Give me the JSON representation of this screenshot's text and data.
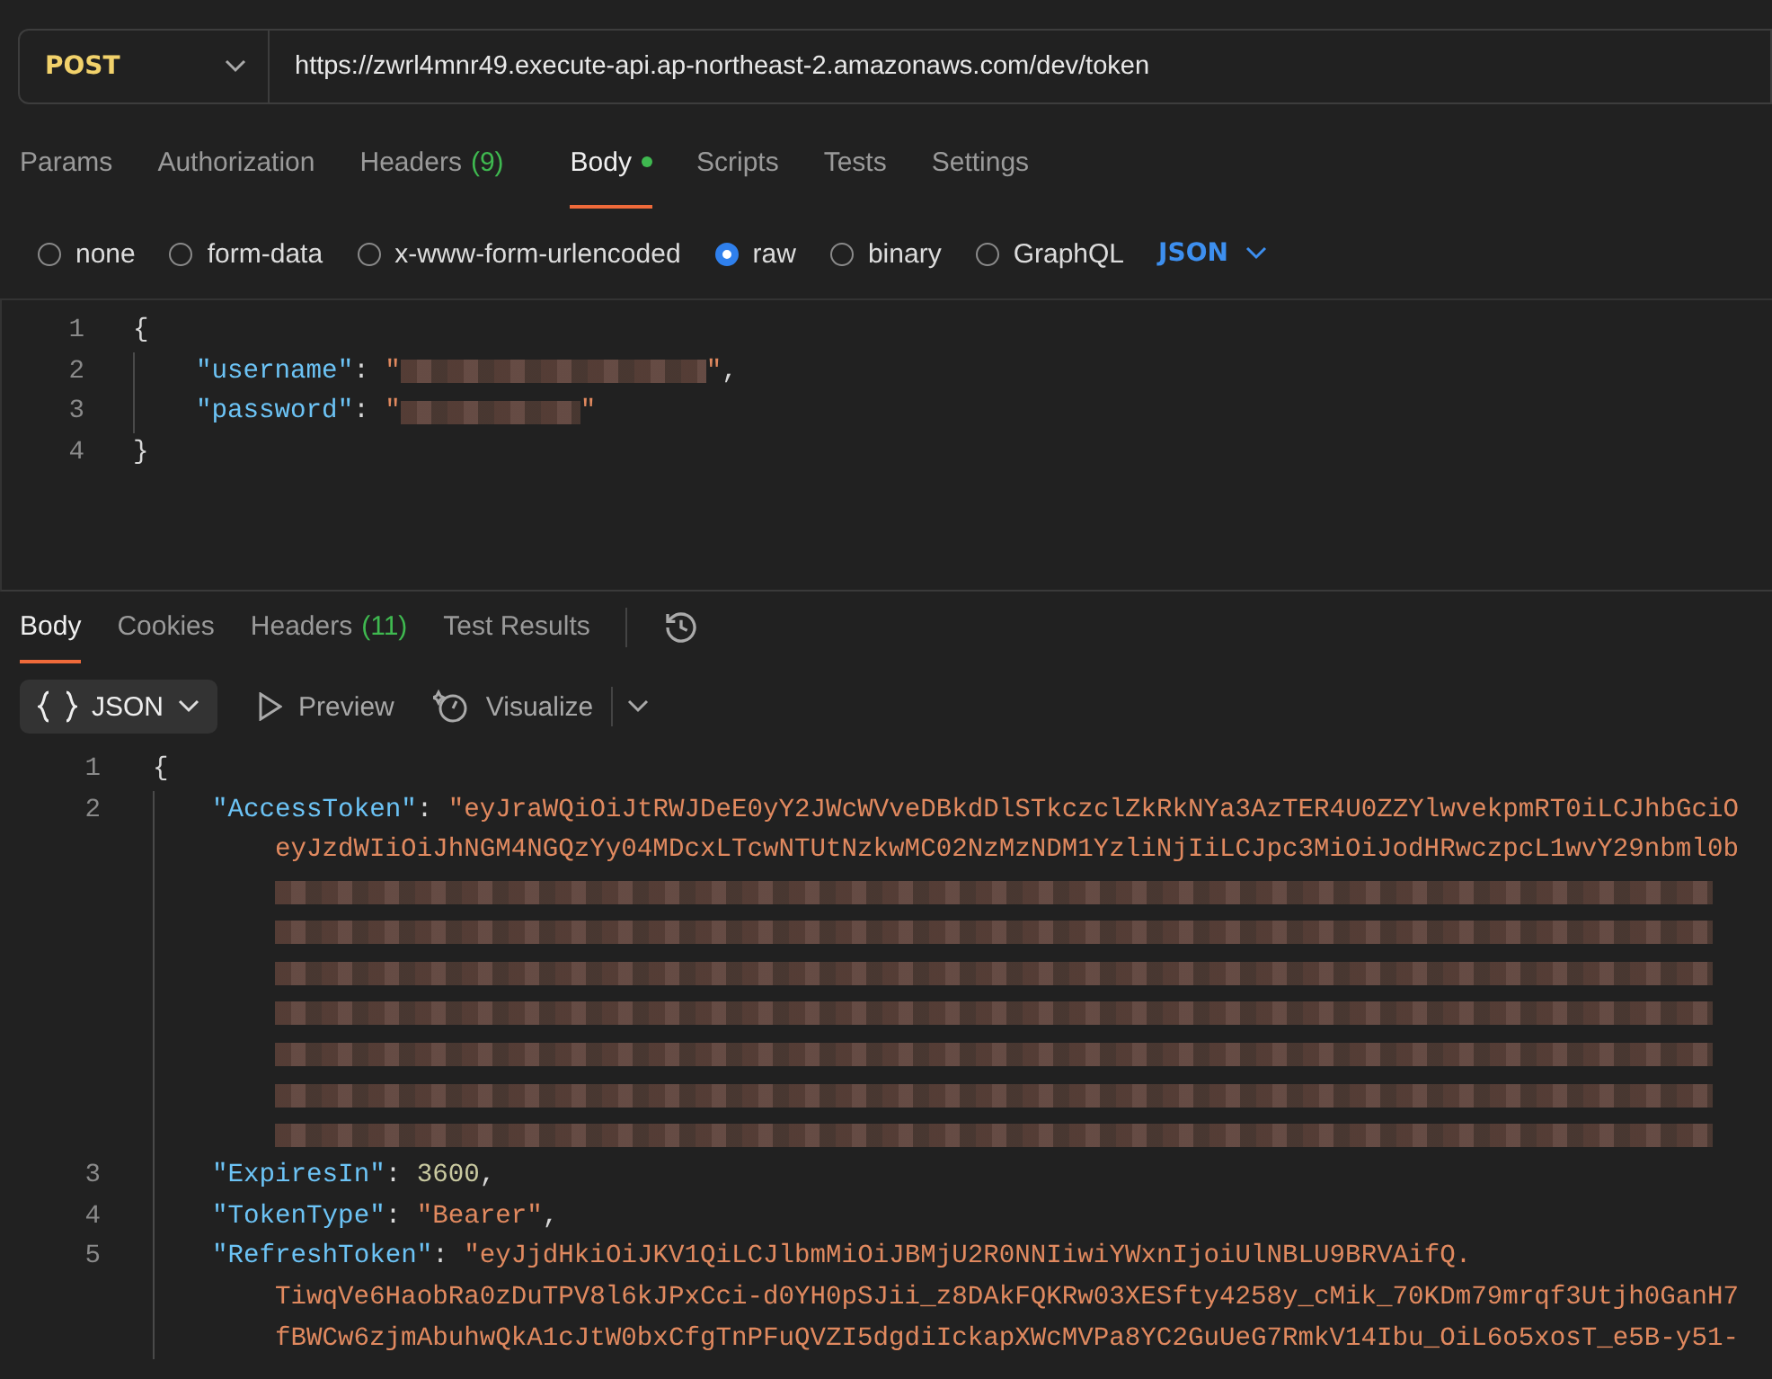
{
  "request": {
    "method": "POST",
    "url": "https://zwrl4mnr49.execute-api.ap-northeast-2.amazonaws.com/dev/token"
  },
  "request_tabs": [
    {
      "label": "Params",
      "selected": false
    },
    {
      "label": "Authorization",
      "selected": false
    },
    {
      "label": "Headers",
      "count": "(9)",
      "selected": false
    },
    {
      "label": "Body",
      "dot": true,
      "selected": true
    },
    {
      "label": "Scripts",
      "selected": false
    },
    {
      "label": "Tests",
      "selected": false
    },
    {
      "label": "Settings",
      "selected": false
    }
  ],
  "body_types": [
    {
      "label": "none",
      "selected": false
    },
    {
      "label": "form-data",
      "selected": false
    },
    {
      "label": "x-www-form-urlencoded",
      "selected": false
    },
    {
      "label": "raw",
      "selected": true
    },
    {
      "label": "binary",
      "selected": false
    },
    {
      "label": "GraphQL",
      "selected": false
    }
  ],
  "raw_format": "JSON",
  "request_body": [
    {
      "number": "1",
      "tokens": [
        {
          "kind": "punct",
          "text": "{"
        }
      ]
    },
    {
      "number": "2",
      "tokens": [
        {
          "kind": "key",
          "text": "\"username\""
        },
        {
          "kind": "punct",
          "text": ": "
        },
        {
          "kind": "string",
          "text": "\""
        },
        {
          "kind": "redacted"
        },
        {
          "kind": "string",
          "text": "\""
        },
        {
          "kind": "punct",
          "text": ","
        }
      ]
    },
    {
      "number": "3",
      "tokens": [
        {
          "kind": "key",
          "text": "\"password\""
        },
        {
          "kind": "punct",
          "text": ": "
        },
        {
          "kind": "string",
          "text": "\""
        },
        {
          "kind": "redacted"
        },
        {
          "kind": "string",
          "text": "\""
        }
      ]
    },
    {
      "number": "4",
      "tokens": [
        {
          "kind": "punct",
          "text": "}"
        }
      ]
    }
  ],
  "response_tabs": [
    {
      "label": "Body",
      "selected": true
    },
    {
      "label": "Cookies",
      "selected": false
    },
    {
      "label": "Headers",
      "count": "(11)",
      "selected": false
    },
    {
      "label": "Test Results",
      "selected": false
    }
  ],
  "response_view": {
    "format": "JSON",
    "preview": "Preview",
    "visualize": "Visualize"
  },
  "response_body": [
    {
      "number": "1",
      "tokens": [
        {
          "kind": "punct",
          "text": "{"
        }
      ]
    },
    {
      "number": "2",
      "tokens": [
        {
          "kind": "key",
          "text": "\"AccessToken\""
        },
        {
          "kind": "punct",
          "text": ": "
        },
        {
          "kind": "string",
          "text": "\"eyJraWQiOiJtRWJDeE0yY2JWcWVveDBkdDlSTkczclZkRkNYa3AzTER4U0ZZYlwvekpmRT0iLCJhbGciO"
        }
      ]
    },
    {
      "tokens": [
        {
          "kind": "string",
          "text": "eyJzdWIiOiJhNGM4NGQzYy04MDcxLTcwNTUtNzkwMC02NzMzNDM1YzliNjIiLCJpc3MiOiJodHRwczpcL1wvY29nbml0b"
        }
      ]
    },
    {
      "tokens": [
        {
          "kind": "redacted"
        }
      ]
    },
    {
      "tokens": [
        {
          "kind": "redacted"
        }
      ]
    },
    {
      "tokens": [
        {
          "kind": "redacted"
        }
      ]
    },
    {
      "tokens": [
        {
          "kind": "redacted"
        }
      ]
    },
    {
      "tokens": [
        {
          "kind": "redacted"
        }
      ]
    },
    {
      "tokens": [
        {
          "kind": "redacted"
        }
      ]
    },
    {
      "tokens": [
        {
          "kind": "redacted"
        }
      ]
    },
    {
      "number": "3",
      "tokens": [
        {
          "kind": "key",
          "text": "\"ExpiresIn\""
        },
        {
          "kind": "punct",
          "text": ": "
        },
        {
          "kind": "number",
          "text": "3600"
        },
        {
          "kind": "punct",
          "text": ","
        }
      ]
    },
    {
      "number": "4",
      "tokens": [
        {
          "kind": "key",
          "text": "\"TokenType\""
        },
        {
          "kind": "punct",
          "text": ": "
        },
        {
          "kind": "string",
          "text": "\"Bearer\""
        },
        {
          "kind": "punct",
          "text": ","
        }
      ]
    },
    {
      "number": "5",
      "tokens": [
        {
          "kind": "key",
          "text": "\"RefreshToken\""
        },
        {
          "kind": "punct",
          "text": ": "
        },
        {
          "kind": "string",
          "text": "\"eyJjdHkiOiJKV1QiLCJlbmMiOiJBMjU2R0NNIiwiYWxnIjoiUlNBLU9BRVAifQ."
        }
      ]
    },
    {
      "tokens": [
        {
          "kind": "string",
          "text": "TiwqVe6HaobRa0zDuTPV8l6kJPxCci-d0YH0pSJii_z8DAkFQKRw03XESfty4258y_cMik_70KDm79mrqf3Utjh0GanH7"
        }
      ]
    },
    {
      "tokens": [
        {
          "kind": "string",
          "text": "fBWCw6zjmAbuhwQkA1cJtW0bxCfgTnPFuQVZI5dgdiIckapXWcMVPa8YC2GuUeG7RmkV14Ibu_OiL6o5xosT_e5B-y51-"
        }
      ]
    }
  ]
}
